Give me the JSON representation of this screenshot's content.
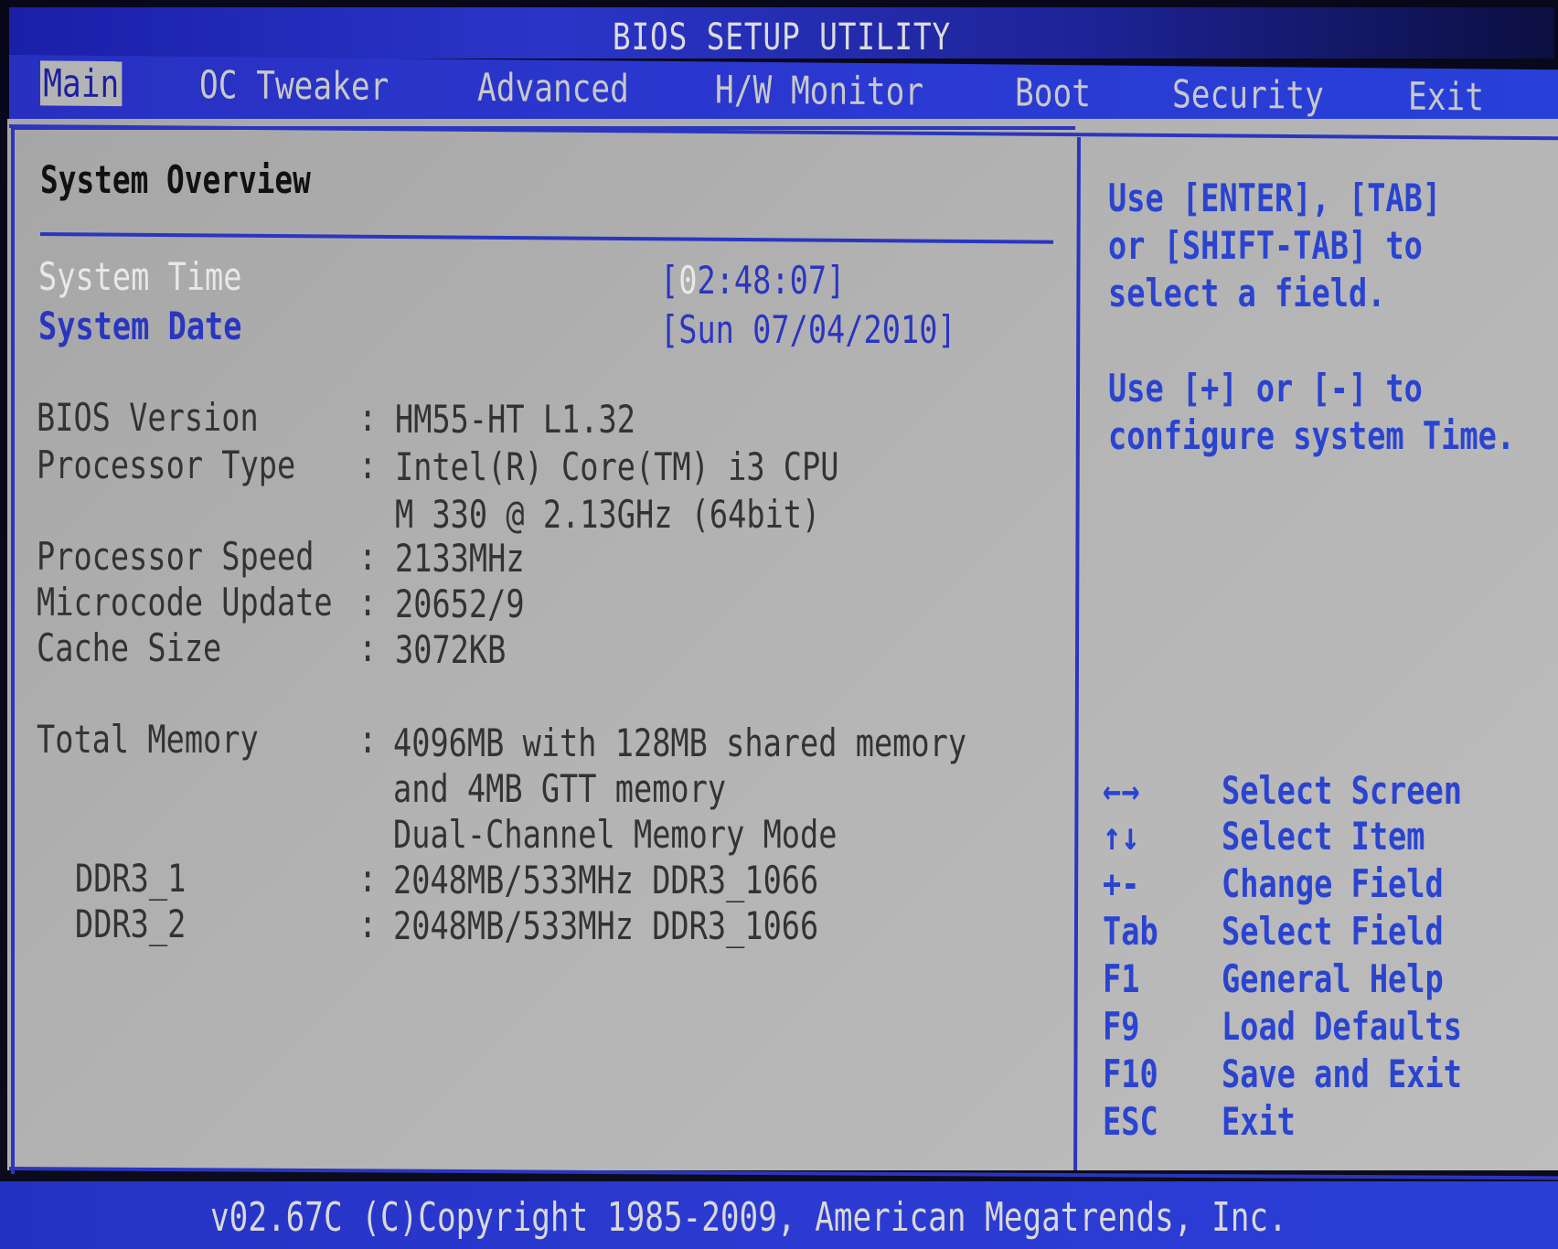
{
  "title": "BIOS SETUP UTILITY",
  "menu": {
    "tabs": [
      {
        "label": "Main",
        "active": true
      },
      {
        "label": "OC Tweaker"
      },
      {
        "label": "Advanced"
      },
      {
        "label": "H/W Monitor"
      },
      {
        "label": "Boot"
      },
      {
        "label": "Security"
      },
      {
        "label": "Exit"
      }
    ]
  },
  "main": {
    "section_title": "System Overview",
    "system_time": {
      "label": "System Time",
      "value_open": "[",
      "value_cursor": "0",
      "value_rest": "2:48:07]"
    },
    "system_date": {
      "label": "System Date",
      "value": "[Sun 07/04/2010]"
    },
    "info": [
      {
        "label": "BIOS Version",
        "sep": ":",
        "value": "HM55-HT L1.32"
      },
      {
        "label": "Processor Type",
        "sep": ":",
        "value": "Intel(R) Core(TM) i3 CPU"
      },
      {
        "label": "",
        "sep": "",
        "value": "M 330  @ 2.13GHz (64bit)"
      },
      {
        "label": "Processor Speed",
        "sep": ":",
        "value": "2133MHz"
      },
      {
        "label": "Microcode Update",
        "sep": ":",
        "value": "20652/9"
      },
      {
        "label": "Cache Size",
        "sep": ":",
        "value": "3072KB"
      }
    ],
    "memory": [
      {
        "label": "Total Memory",
        "sep": ":",
        "value": "4096MB with 128MB shared memory"
      },
      {
        "label": "",
        "sep": "",
        "value": "and 4MB GTT memory"
      },
      {
        "label": "",
        "sep": "",
        "value": "Dual-Channel Memory Mode"
      },
      {
        "label": "DDR3_1",
        "sep": ":",
        "value": "2048MB/533MHz  DDR3_1066"
      },
      {
        "label": "DDR3_2",
        "sep": ":",
        "value": "2048MB/533MHz  DDR3_1066"
      }
    ]
  },
  "help": {
    "lines": [
      "Use [ENTER], [TAB]",
      "or [SHIFT-TAB] to",
      "select a field.",
      "",
      "Use [+] or [-] to",
      "configure system Time."
    ],
    "keys": [
      {
        "key": "←→",
        "icon": "left-right-arrows-icon",
        "desc": "Select Screen"
      },
      {
        "key": "↑↓",
        "icon": "up-down-arrows-icon",
        "desc": "Select Item"
      },
      {
        "key": "+-",
        "icon": "plus-minus-icon",
        "desc": "Change Field"
      },
      {
        "key": "Tab",
        "desc": "Select Field"
      },
      {
        "key": "F1",
        "desc": "General Help"
      },
      {
        "key": "F9",
        "desc": "Load Defaults"
      },
      {
        "key": "F10",
        "desc": "Save and Exit"
      },
      {
        "key": "ESC",
        "desc": "Exit"
      }
    ]
  },
  "footer": "v02.67C (C)Copyright 1985-2009, American Megatrends, Inc.",
  "colors": {
    "frame_blue": "#2a36c0",
    "panel_gray": "#b3b3b3",
    "help_blue": "#2a44d0",
    "text_dark": "#333333",
    "selected_text": "#e8e8e8"
  }
}
